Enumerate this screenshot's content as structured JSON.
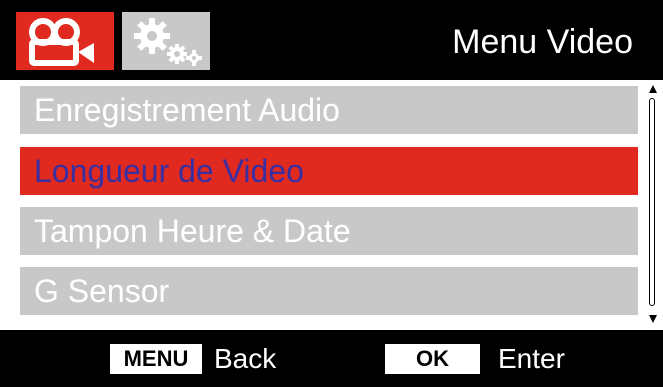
{
  "header": {
    "tabs": [
      {
        "icon": "video-camera-icon",
        "active": true,
        "color": "#e0291f"
      },
      {
        "icon": "gears-icon",
        "active": false,
        "color": "#c8c8c8"
      }
    ],
    "title": "Menu Video"
  },
  "menu": {
    "items": [
      {
        "label": "Enregistrement Audio",
        "selected": false
      },
      {
        "label": "Longueur de Video",
        "selected": true
      },
      {
        "label": "Tampon Heure & Date",
        "selected": false
      },
      {
        "label": "G Sensor",
        "selected": false
      }
    ],
    "colors": {
      "item": "#c8c8c8",
      "selected": "#e0291f",
      "selected_text": "#3a2fa0"
    }
  },
  "footer": {
    "menu_key": "MENU",
    "back_label": "Back",
    "ok_key": "OK",
    "enter_label": "Enter"
  }
}
